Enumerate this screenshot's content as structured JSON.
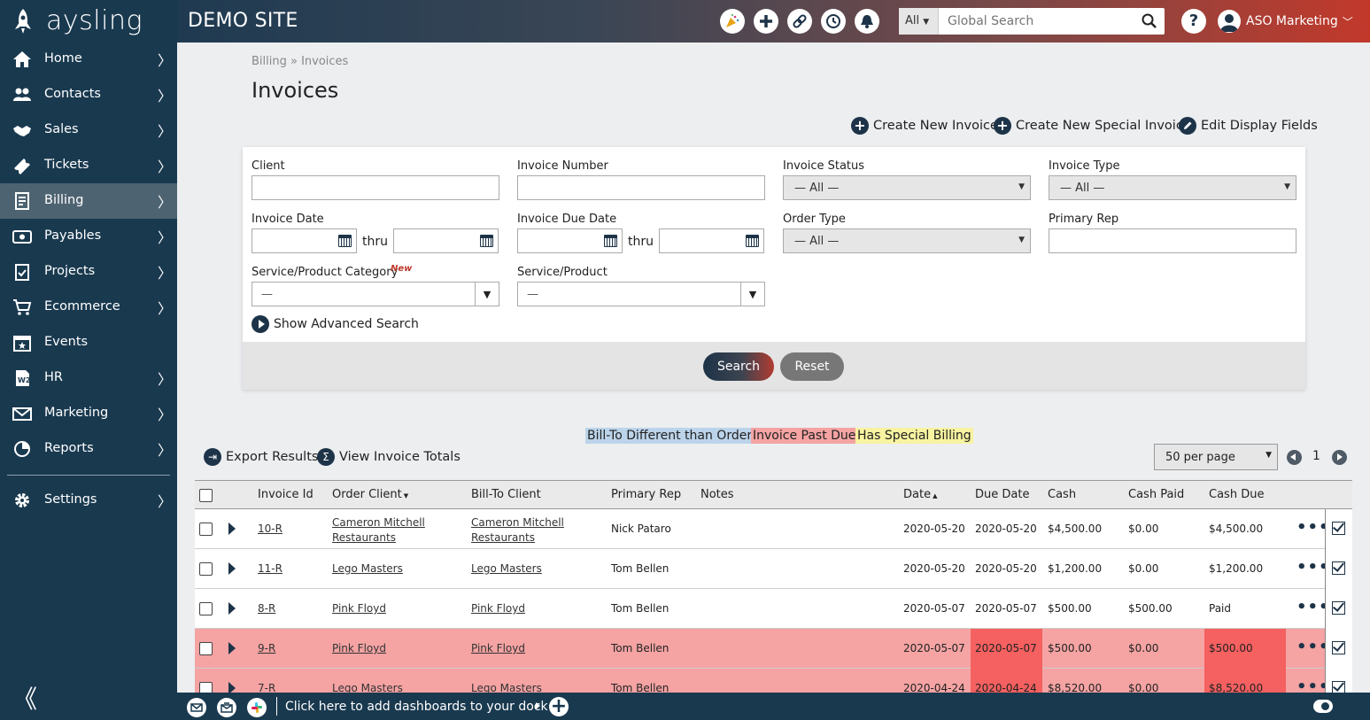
{
  "app": {
    "logo_text": "aysling",
    "site_title": "DEMO SITE"
  },
  "sidebar": {
    "items": [
      {
        "label": "Home",
        "icon": "home-icon"
      },
      {
        "label": "Contacts",
        "icon": "contacts-icon"
      },
      {
        "label": "Sales",
        "icon": "handshake-icon"
      },
      {
        "label": "Tickets",
        "icon": "ticket-icon"
      },
      {
        "label": "Billing",
        "icon": "billing-icon",
        "active": true
      },
      {
        "label": "Payables",
        "icon": "payables-icon"
      },
      {
        "label": "Projects",
        "icon": "clipboard-icon"
      },
      {
        "label": "Ecommerce",
        "icon": "cart-icon"
      },
      {
        "label": "Events",
        "icon": "calendar-icon"
      },
      {
        "label": "HR",
        "icon": "w2-icon"
      },
      {
        "label": "Marketing",
        "icon": "envelope-icon"
      },
      {
        "label": "Reports",
        "icon": "reports-icon"
      },
      {
        "label": "Settings",
        "icon": "gear-icon"
      }
    ],
    "chevron": "〉",
    "collapse": "《"
  },
  "topbar": {
    "search_scope": "All",
    "search_placeholder": "Global Search",
    "help": "?",
    "user": "ASO Marketing",
    "user_caret": "﹀"
  },
  "page": {
    "breadcrumb": "Billing » Invoices",
    "title": "Invoices",
    "actions": {
      "create": "Create New Invoice",
      "create_special": "Create New Special Invoice",
      "edit_fields": "Edit Display Fields"
    }
  },
  "filters": {
    "client": "Client",
    "invoice_number": "Invoice Number",
    "invoice_status": "Invoice Status",
    "invoice_type": "Invoice Type",
    "invoice_date": "Invoice Date",
    "invoice_due_date": "Invoice Due Date",
    "order_type": "Order Type",
    "primary_rep": "Primary Rep",
    "service_category": "Service/Product Category",
    "new_tag": "New",
    "service_product": "Service/Product",
    "all_option": "— All —",
    "dash_option": "—",
    "thru": "thru",
    "advanced": "Show Advanced Search",
    "search_btn": "Search",
    "reset_btn": "Reset"
  },
  "legend": {
    "bill_to": "Bill-To Different than Order",
    "past_due": "Invoice Past Due",
    "special": "Has Special Billing",
    "colors": {
      "bill_to": "#bcd4ea",
      "past_due": "#f5a3a3",
      "special": "#f7f3a0"
    }
  },
  "tools": {
    "export": "Export Results",
    "totals": "View Invoice Totals",
    "per_page": "50 per page",
    "page": "1"
  },
  "table": {
    "headers": {
      "id": "Invoice Id",
      "order_client": "Order Client",
      "bill_to": "Bill-To Client",
      "rep": "Primary Rep",
      "notes": "Notes",
      "date": "Date",
      "due": "Due Date",
      "cash": "Cash",
      "paid": "Cash Paid",
      "cash_due": "Cash Due"
    },
    "rows": [
      {
        "id": "10-R",
        "order_client": "Cameron Mitchell Restaurants",
        "bill_to": "Cameron Mitchell Restaurants",
        "rep": "Nick Pataro",
        "date": "2020-05-20",
        "due": "2020-05-20",
        "cash": "$4,500.00",
        "paid": "$0.00",
        "cash_due": "$4,500.00",
        "past_due": false
      },
      {
        "id": "11-R",
        "order_client": "Lego Masters",
        "bill_to": "Lego Masters",
        "rep": "Tom Bellen",
        "date": "2020-05-20",
        "due": "2020-05-20",
        "cash": "$1,200.00",
        "paid": "$0.00",
        "cash_due": "$1,200.00",
        "past_due": false
      },
      {
        "id": "8-R",
        "order_client": "Pink Floyd",
        "bill_to": "Pink Floyd",
        "rep": "Tom Bellen",
        "date": "2020-05-07",
        "due": "2020-05-07",
        "cash": "$500.00",
        "paid": "$500.00",
        "cash_due": "Paid",
        "past_due": false
      },
      {
        "id": "9-R",
        "order_client": "Pink Floyd",
        "bill_to": "Pink Floyd",
        "rep": "Tom Bellen",
        "date": "2020-05-07",
        "due": "2020-05-07",
        "cash": "$500.00",
        "paid": "$0.00",
        "cash_due": "$500.00",
        "past_due": true
      },
      {
        "id": "7-R",
        "order_client": "Lego Masters",
        "bill_to": "Lego Masters",
        "rep": "Tom Bellen",
        "date": "2020-04-24",
        "due": "2020-04-24",
        "cash": "$8,520.00",
        "paid": "$0.00",
        "cash_due": "$8,520.00",
        "past_due": true
      }
    ]
  },
  "dock": {
    "text": "Click here to add dashboards to your dock"
  }
}
